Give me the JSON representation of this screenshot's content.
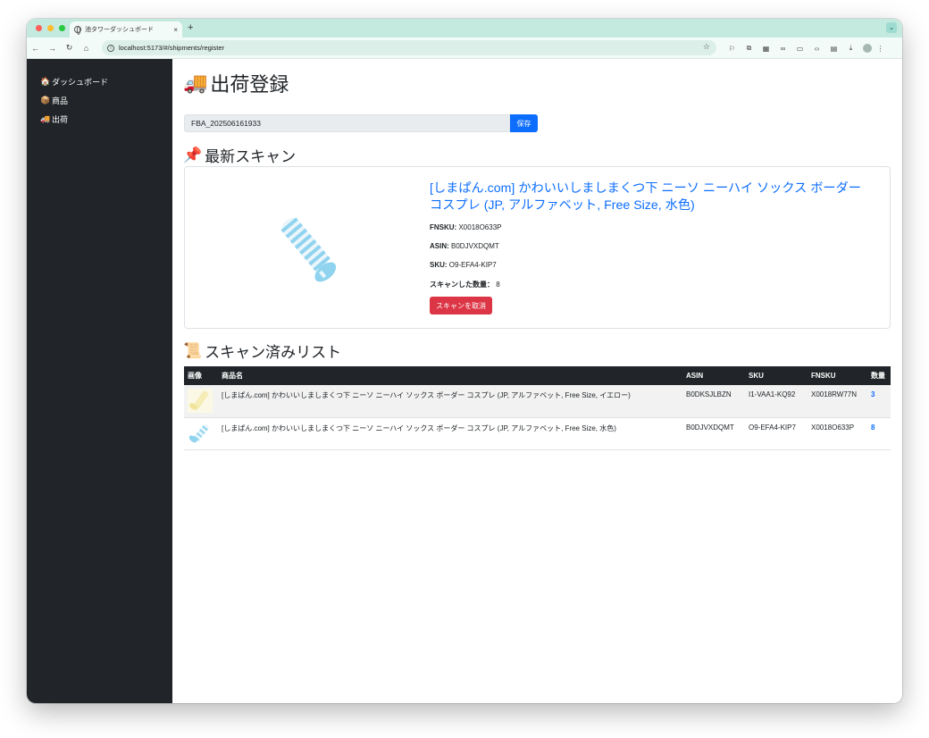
{
  "browser": {
    "tab_title": "池タワーダッシュボード",
    "tab_close": "×",
    "new_tab": "+",
    "url": "localhost:5173/#/shipments/register",
    "tab_menu": "⌄"
  },
  "sidebar": {
    "items": [
      {
        "emoji": "🏠",
        "label": "ダッシュボード"
      },
      {
        "emoji": "📦",
        "label": "商品"
      },
      {
        "emoji": "🚚",
        "label": "出荷"
      }
    ]
  },
  "page": {
    "emoji": "🚚",
    "title": "出荷登録",
    "shipment_name": "FBA_20250616​1933",
    "save_label": "保存"
  },
  "latest_scan": {
    "emoji": "📌",
    "heading": "最新スキャン",
    "product_title": "[しまぱん.com] かわいいしましまくつ下 ニーソ ニーハイ ソックス ボーダー コスプレ (JP, アルファベット, Free Size, 水色)",
    "fnsku_label": "FNSKU:",
    "fnsku": "X0018O633P",
    "asin_label": "ASIN:",
    "asin": "B0DJVXDQMT",
    "sku_label": "SKU:",
    "sku": "O9-EFA4-KIP7",
    "qty_label": "スキャンした数量：",
    "qty": "8",
    "cancel_label": "スキャンを取消"
  },
  "scanned_list": {
    "emoji": "📜",
    "heading": "スキャン済みリスト",
    "columns": [
      "画像",
      "商品名",
      "ASIN",
      "SKU",
      "FNSKU",
      "数量"
    ],
    "rows": [
      {
        "image_color": "#f5edb5",
        "name": "[しまぱん.com] かわいいしましまくつ下 ニーソ ニーハイ ソックス ボーダー コスプレ (JP, アルファベット, Free Size, イエロー)",
        "asin": "B0DKSJLBZN",
        "sku": "I1-VAA1-KQ92",
        "fnsku": "X0018RW77N",
        "qty": "3"
      },
      {
        "image_color": "#8fd3ef",
        "name": "[しまぱん.com] かわいいしましまくつ下 ニーソ ニーハイ ソックス ボーダー コスプレ (JP, アルファベット, Free Size, 水色)",
        "asin": "B0DJVXDQMT",
        "sku": "O9-EFA4-KIP7",
        "fnsku": "X0018O633P",
        "qty": "8"
      }
    ]
  }
}
